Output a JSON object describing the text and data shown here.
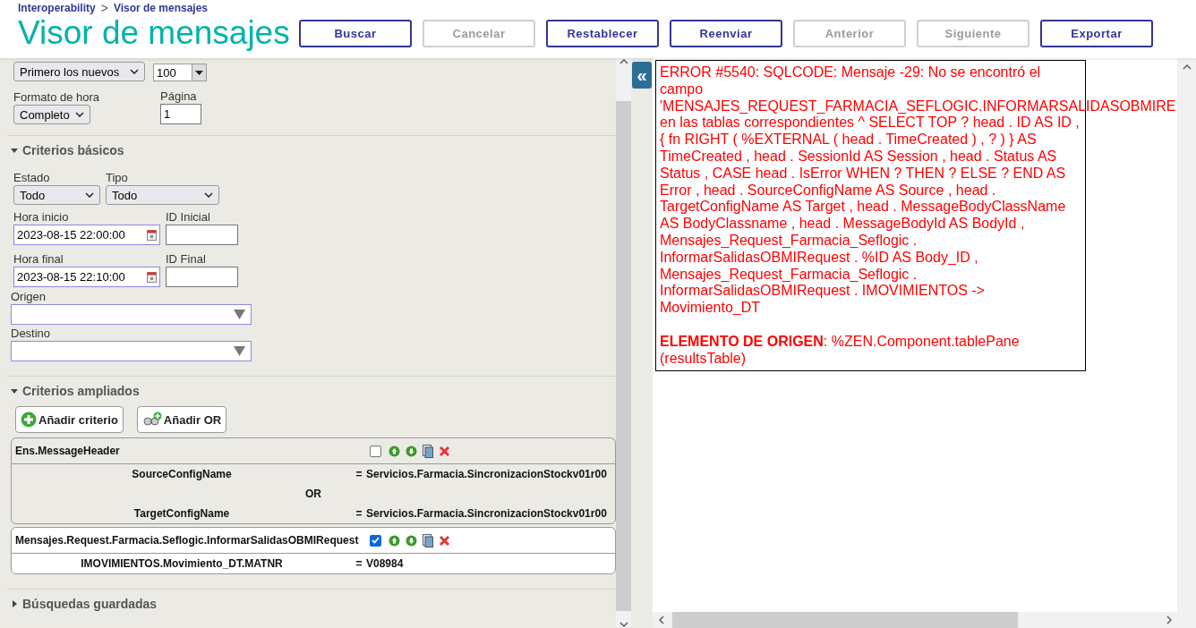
{
  "breadcrumb": {
    "items": [
      "Interoperability",
      "Visor de mensajes"
    ],
    "separator": ">"
  },
  "title": "Visor de mensajes",
  "buttons": [
    {
      "label": "Buscar",
      "disabled": false
    },
    {
      "label": "Cancelar",
      "disabled": true
    },
    {
      "label": "Restablecer",
      "disabled": false
    },
    {
      "label": "Reenviar",
      "disabled": false
    },
    {
      "label": "Anterior",
      "disabled": true
    },
    {
      "label": "Siguiente",
      "disabled": true
    },
    {
      "label": "Exportar",
      "disabled": false
    }
  ],
  "options": {
    "sort": "Primero los nuevos",
    "page_size": "100",
    "time_format": {
      "label": "Formato de hora",
      "value": "Completo"
    },
    "page": {
      "label": "Página",
      "value": "1"
    }
  },
  "basic": {
    "title": "Criterios básicos",
    "expanded": true,
    "estado": {
      "label": "Estado",
      "value": "Todo"
    },
    "tipo": {
      "label": "Tipo",
      "value": "Todo"
    },
    "start": {
      "label": "Hora inicio",
      "value": "2023-08-15 22:00:00"
    },
    "start_id": {
      "label": "ID Inicial"
    },
    "end": {
      "label": "Hora final",
      "value": "2023-08-15 22:10:00"
    },
    "end_id": {
      "label": "ID Final"
    },
    "origin": {
      "label": "Origen"
    },
    "target": {
      "label": "Destino"
    }
  },
  "extended": {
    "title": "Criterios ampliados",
    "expanded": true,
    "buttons": [
      "Añadir criterio",
      "Añadir OR"
    ],
    "groups": [
      {
        "class": "Ens.MessageHeader",
        "checked": false,
        "conditions": [
          {
            "kind": "condition",
            "field": "SourceConfigName",
            "op": "=",
            "value": "Servicios.Farmacia.SincronizacionStockv01r00"
          },
          {
            "kind": "or",
            "label": "OR"
          },
          {
            "kind": "condition",
            "field": "TargetConfigName",
            "op": "=",
            "value": "Servicios.Farmacia.SincronizacionStockv01r00"
          }
        ]
      },
      {
        "class": "Mensajes.Request.Farmacia.Seflogic.InformarSalidasOBMIRequest",
        "checked": true,
        "conditions": [
          {
            "kind": "condition",
            "field": "IMOVIMIENTOS.Movimiento_DT.MATNR",
            "op": "=",
            "value": "V08984"
          }
        ]
      }
    ]
  },
  "saved": {
    "title": "Búsquedas guardadas",
    "expanded": false
  },
  "collapse_button": "«",
  "error": {
    "message": "ERROR #5540: SQLCODE: Mensaje -29: No se encontró el campo 'MENSAJES_REQUEST_FARMACIA_SEFLOGIC.INFORMARSALIDASOBMIRE en las tablas correspondientes ^ SELECT TOP ? head . ID AS ID , { fn RIGHT ( %EXTERNAL ( head . TimeCreated ) , ? ) } AS TimeCreated , head . SessionId AS Session , head . Status AS Status , CASE head . IsError WHEN ? THEN ? ELSE ? END AS Error , head . SourceConfigName AS Source , head . TargetConfigName AS Target , head . MessageBodyClassName AS BodyClassname , head . MessageBodyId AS BodyId , Mensajes_Request_Farmacia_Seflogic . InformarSalidasOBMIRequest . %ID AS Body_ID , Mensajes_Request_Farmacia_Seflogic . InformarSalidasOBMIRequest . IMOVIMIENTOS -> Movimiento_DT",
    "source": "**ELEMENTO DE ORIGEN**: %ZEN.Component.tablePane (resultsTable)"
  }
}
